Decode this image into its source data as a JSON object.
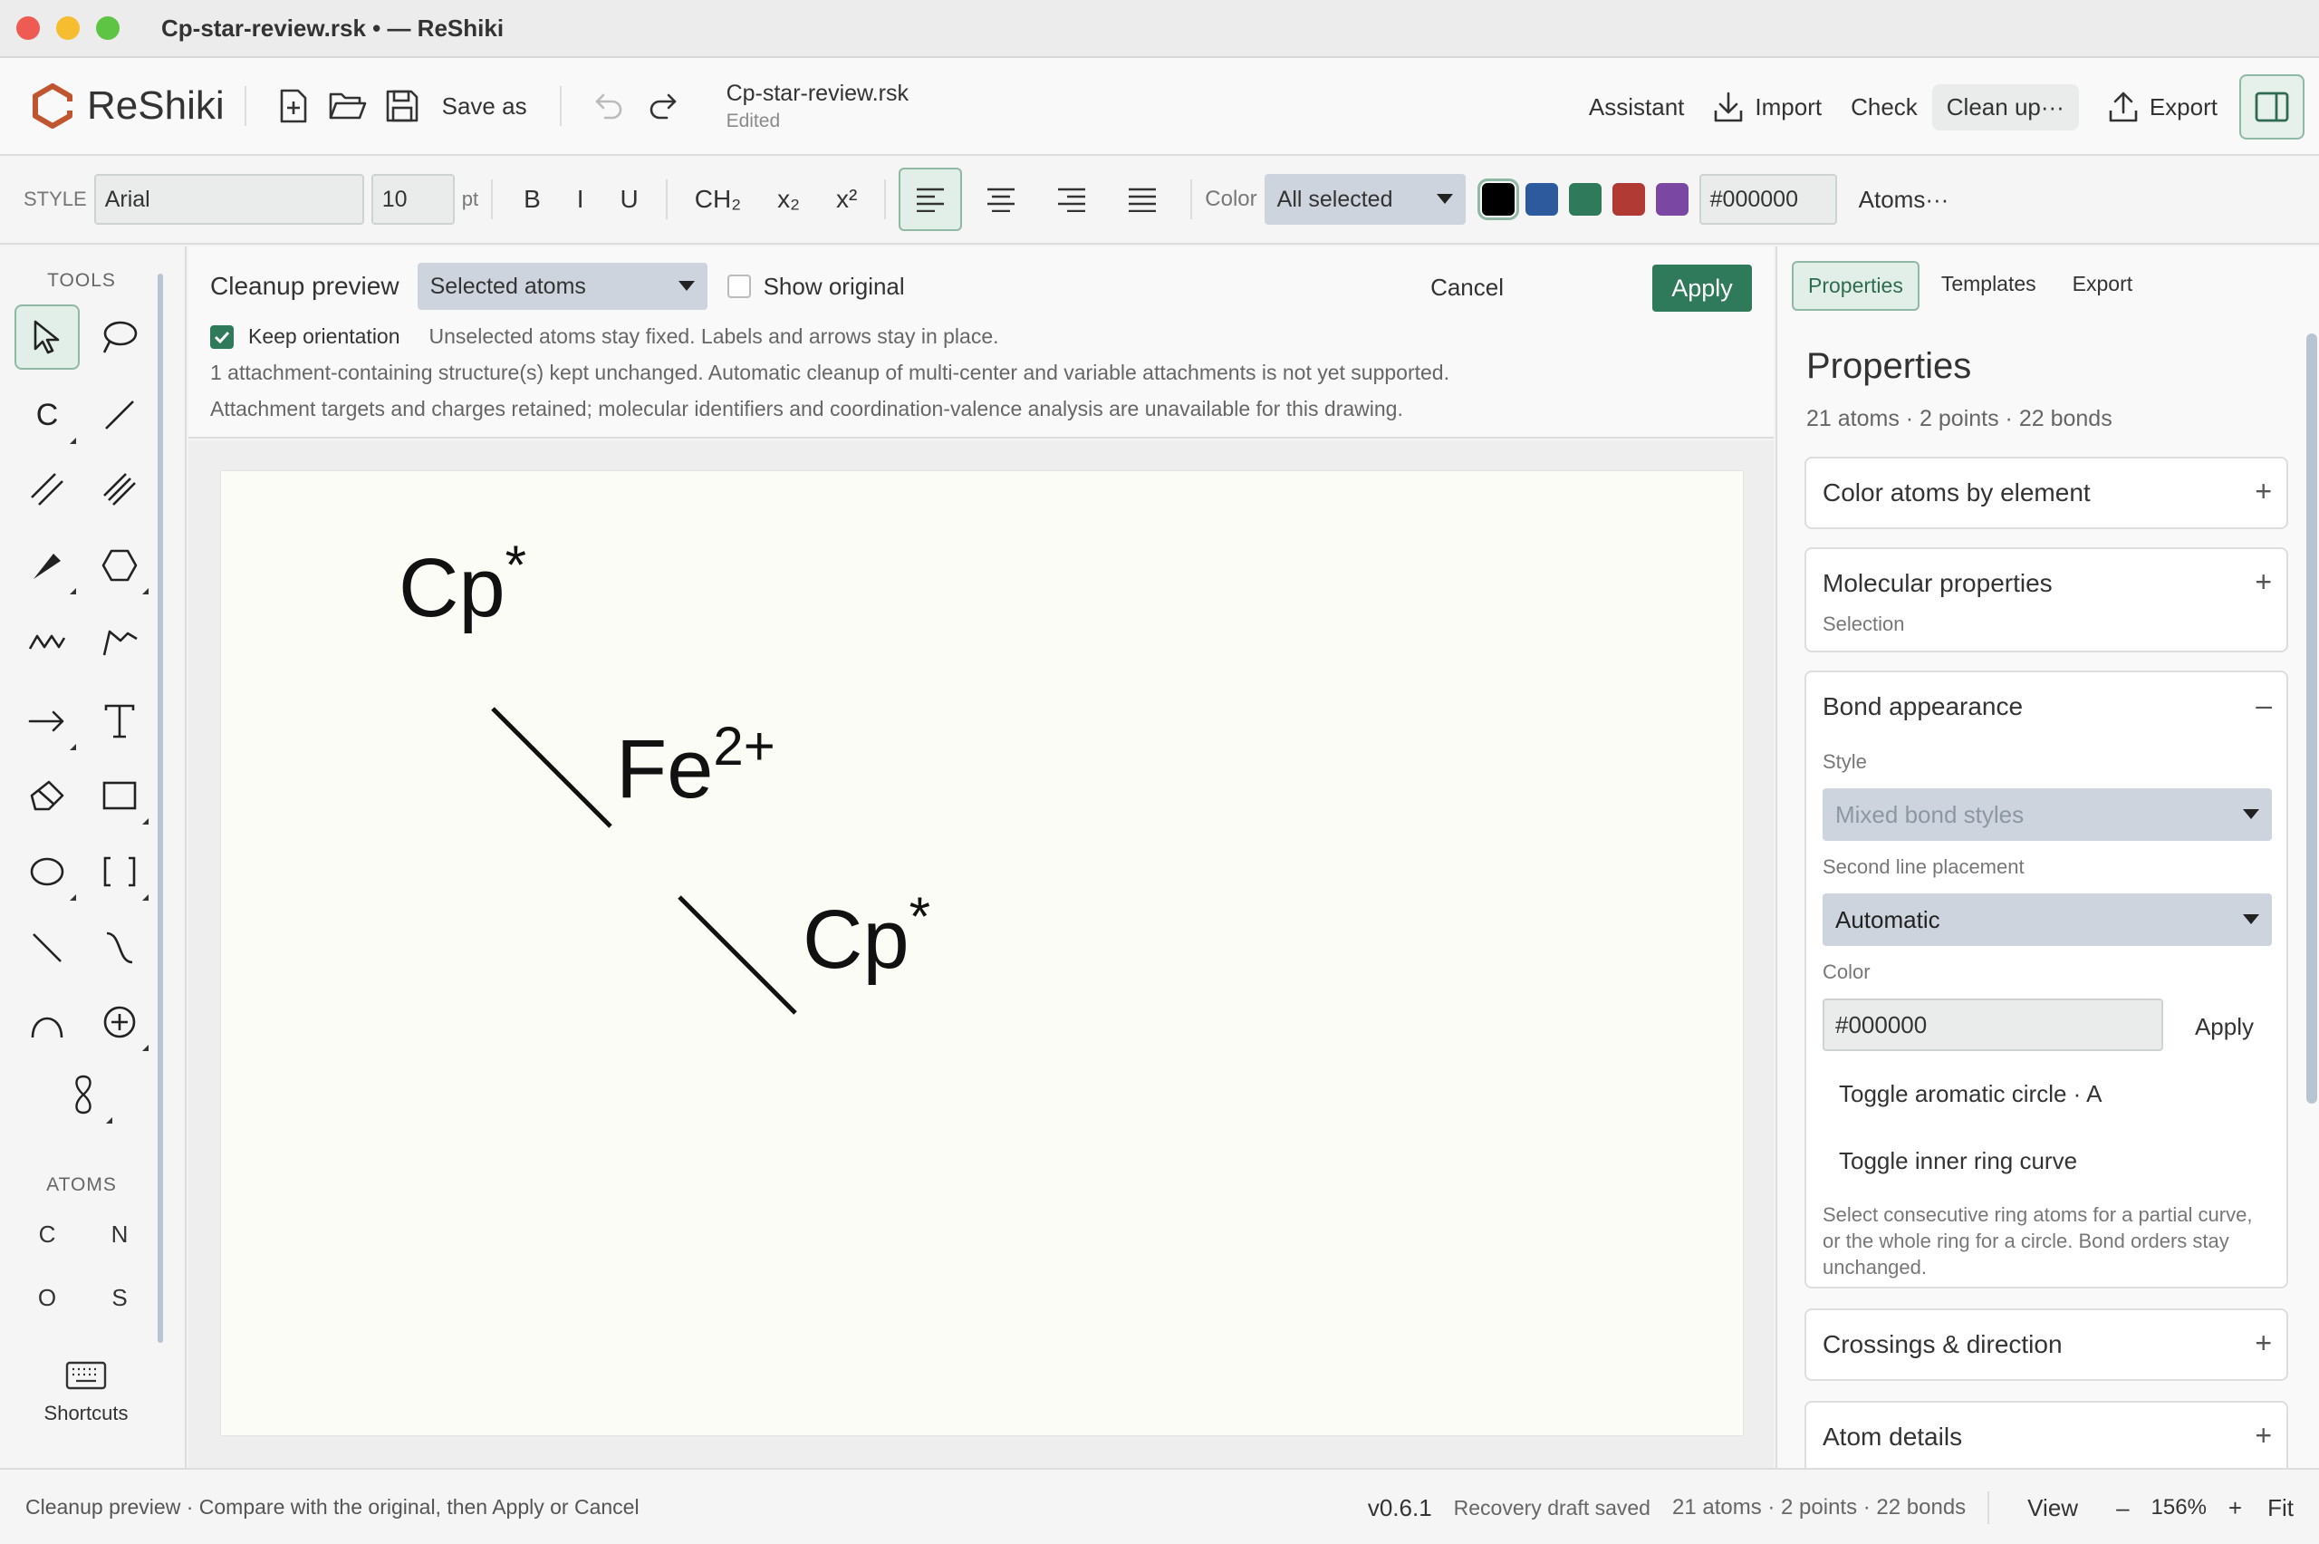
{
  "window": {
    "title": "Cp-star-review.rsk • — ReShiki"
  },
  "app": {
    "name": "ReShiki",
    "save_as": "Save as",
    "doc_name": "Cp-star-review.rsk",
    "doc_status": "Edited",
    "assistant": "Assistant",
    "import": "Import",
    "check": "Check",
    "clean_up": "Clean up···",
    "export": "Export"
  },
  "stylebar": {
    "style_label": "STYLE",
    "font": "Arial",
    "size": "10",
    "size_unit": "pt",
    "bold": "B",
    "italic": "I",
    "underline": "U",
    "ch2": "CH₂",
    "subscript": "x₂",
    "superscript": "x²",
    "color_label": "Color",
    "color_scope": "All selected",
    "swatches": [
      "#000000",
      "#2d5a9c",
      "#2f7a5b",
      "#b13a35",
      "#7a47a3"
    ],
    "hex": "#000000",
    "atoms_menu": "Atoms···"
  },
  "tools": {
    "label": "TOOLS",
    "atoms_label": "ATOMS",
    "carbon_tool": "C",
    "atoms": [
      "C",
      "N",
      "O",
      "S"
    ],
    "shortcuts": "Shortcuts"
  },
  "cleanup": {
    "title": "Cleanup preview",
    "scope": "Selected atoms",
    "show_original": "Show original",
    "cancel": "Cancel",
    "apply": "Apply",
    "keep_orientation": "Keep orientation",
    "hint": "Unselected atoms stay fixed. Labels and arrows stay in place.",
    "info1": "1 attachment-containing structure(s) kept unchanged. Automatic cleanup of multi-center and variable attachments is not yet supported.",
    "info2": "Attachment targets and charges retained; molecular identifiers and coordination-valence analysis are unavailable for this drawing."
  },
  "drawing": {
    "top_label": "Cp",
    "top_sup": "*",
    "metal": "Fe",
    "metal_sup": "2+",
    "bottom_label": "Cp",
    "bottom_sup": "*"
  },
  "panel": {
    "tabs": [
      "Properties",
      "Templates",
      "Export"
    ],
    "title": "Properties",
    "summary": "21 atoms · 2 points · 22 bonds",
    "color_atoms": "Color atoms by element",
    "molecular": "Molecular properties",
    "molecular_sub": "Selection",
    "bond_appearance": "Bond appearance",
    "style_label": "Style",
    "style_value": "Mixed bond styles",
    "second_line_label": "Second line placement",
    "second_line_value": "Automatic",
    "color_label": "Color",
    "color_value": "#000000",
    "apply": "Apply",
    "toggle_aromatic": "Toggle aromatic circle · A",
    "toggle_inner": "Toggle inner ring curve",
    "note": "Select consecutive ring atoms for a partial curve, or the whole ring for a circle. Bond orders stay unchanged.",
    "crossings": "Crossings & direction",
    "atom_details": "Atom details"
  },
  "status": {
    "left": "Cleanup preview · Compare with the original, then Apply or Cancel",
    "version": "v0.6.1",
    "draft": "Recovery draft saved",
    "counts": "21 atoms · 2 points · 22 bonds",
    "view": "View",
    "zoom_out": "–",
    "zoom": "156%",
    "zoom_in": "+",
    "fit": "Fit"
  }
}
